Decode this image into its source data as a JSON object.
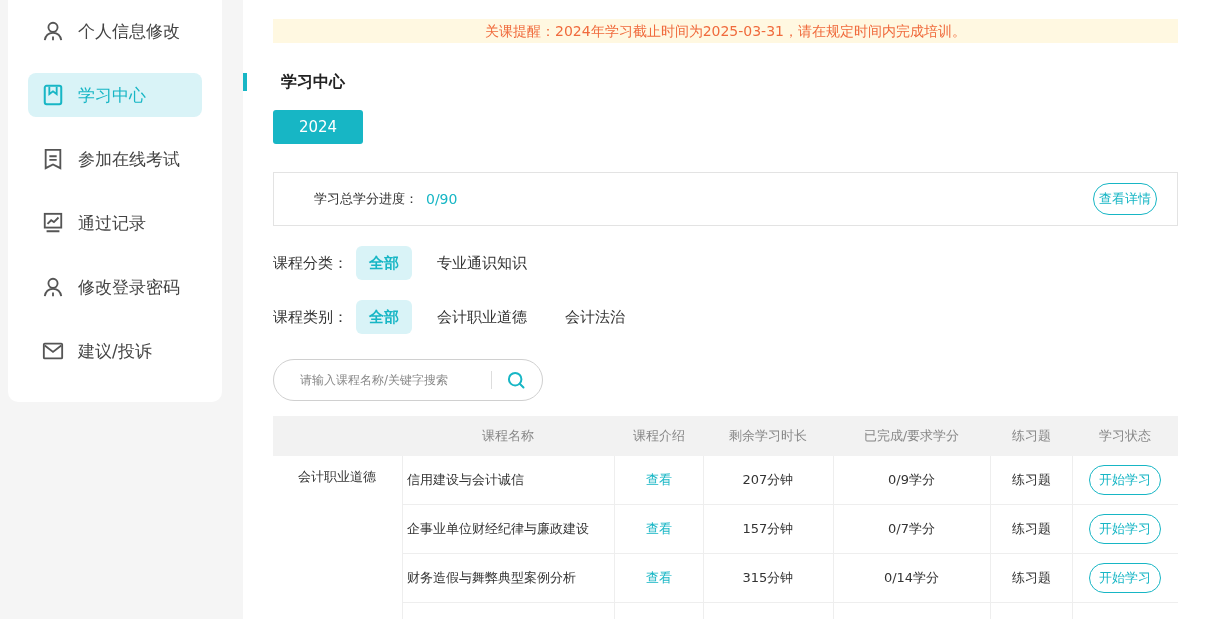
{
  "sidebar": {
    "items": [
      {
        "label": "个人信息修改",
        "kind": "person",
        "selected": false
      },
      {
        "label": "学习中心",
        "kind": "book",
        "selected": true
      },
      {
        "label": "参加在线考试",
        "kind": "exam",
        "selected": false
      },
      {
        "label": "通过记录",
        "kind": "chart",
        "selected": false
      },
      {
        "label": "修改登录密码",
        "kind": "person",
        "selected": false
      },
      {
        "label": "建议/投诉",
        "kind": "mail",
        "selected": false
      }
    ]
  },
  "notice": "关课提醒：2024年学习截止时间为2025-03-31，请在规定时间内完成培训。",
  "section_title": "学习中心",
  "year_tabs": [
    {
      "label": "2024",
      "selected": true
    }
  ],
  "progress": {
    "label": "学习总学分进度：",
    "value": "0/90",
    "button": "查看详情"
  },
  "filters": [
    {
      "label": "课程分类：",
      "options": [
        {
          "label": "全部",
          "selected": true
        },
        {
          "label": "专业通识知识",
          "selected": false
        }
      ]
    },
    {
      "label": "课程类别：",
      "options": [
        {
          "label": "全部",
          "selected": true
        },
        {
          "label": "会计职业道德",
          "selected": false
        },
        {
          "label": "会计法治",
          "selected": false
        }
      ]
    }
  ],
  "search": {
    "placeholder": "请输入课程名称/关键字搜索"
  },
  "table": {
    "columns": [
      "课程名称",
      "课程介绍",
      "剩余学习时长",
      "已完成/要求学分",
      "练习题",
      "学习状态"
    ],
    "groups": [
      {
        "category": "会计职业道德",
        "rows": [
          {
            "name": "信用建设与会计诚信",
            "intro": "查看",
            "remaining": "207分钟",
            "credits": "0/9学分",
            "practice": "练习题",
            "action": "开始学习"
          },
          {
            "name": "企事业单位财经纪律与廉政建设",
            "intro": "查看",
            "remaining": "157分钟",
            "credits": "0/7学分",
            "practice": "练习题",
            "action": "开始学习"
          },
          {
            "name": "财务造假与舞弊典型案例分析",
            "intro": "查看",
            "remaining": "315分钟",
            "credits": "0/14学分",
            "practice": "练习题",
            "action": "开始学习"
          }
        ]
      }
    ]
  }
}
